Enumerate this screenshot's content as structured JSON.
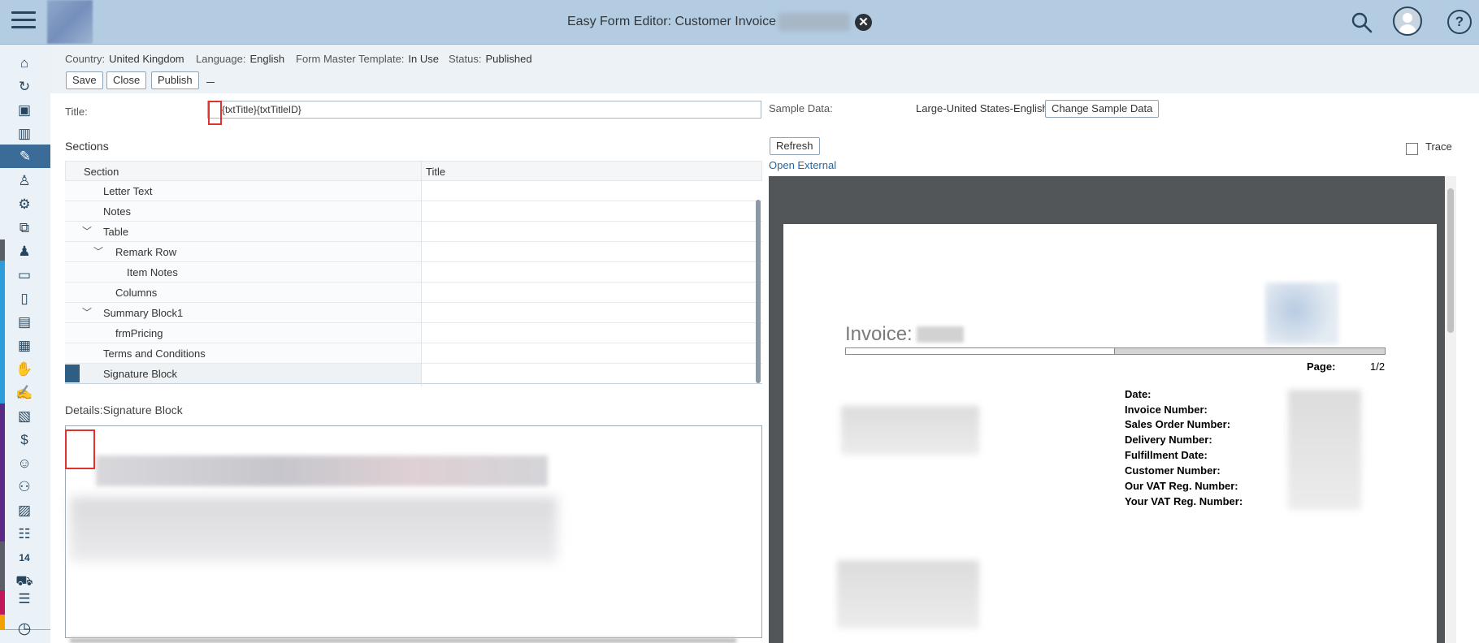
{
  "shell": {
    "app_title": "Easy Form Editor: Customer Invoice",
    "icons": [
      "menu-icon",
      "search-icon",
      "user-avatar-icon",
      "help-icon"
    ]
  },
  "side_nav": {
    "items": [
      "home-icon",
      "refresh-icon",
      "analytics-icon",
      "bar-chart-icon",
      "edit-icon",
      "user-lock-icon",
      "settings-icon",
      "hierarchy-icon",
      "user-list-icon",
      "id-card-icon",
      "document-icon",
      "document-chart-icon",
      "clipboard-icon",
      "handshake-icon",
      "form-edit-icon",
      "ledger-icon",
      "invoice-check-icon",
      "person-icon",
      "network-icon",
      "calendar-edit-icon",
      "group-icon",
      "calendar-14-icon",
      "car-icon",
      "list-icon",
      "history-icon"
    ],
    "calendar_day": "14",
    "active_index": 4,
    "colors": {
      "accent": "#3b6c98",
      "bar_blue": "#2d9cdb",
      "bar_purple": "#5b2a86",
      "bar_magenta": "#c2185b",
      "bar_orange": "#f2a100"
    }
  },
  "form_meta": {
    "country_label": "Country:",
    "country_value": "United Kingdom",
    "language_label": "Language:",
    "language_value": "English",
    "template_label": "Form Master Template:",
    "template_value": "In Use",
    "status_label": "Status:",
    "status_value": "Published"
  },
  "toolbar": {
    "save_label": "Save",
    "close_label": "Close",
    "publish_label": "Publish"
  },
  "title_field": {
    "label": "Title:",
    "value": "{txtTitle}{txtTitleID}"
  },
  "sections": {
    "heading": "Sections",
    "columns": [
      "Section",
      "Title"
    ],
    "rows": [
      {
        "label": "Letter Text",
        "level": 1,
        "expand": ""
      },
      {
        "label": "Notes",
        "level": 1,
        "expand": ""
      },
      {
        "label": "Table",
        "level": 1,
        "expand": "collapse"
      },
      {
        "label": "Remark Row",
        "level": 2,
        "expand": "collapse"
      },
      {
        "label": "Item Notes",
        "level": 3,
        "expand": ""
      },
      {
        "label": "Columns",
        "level": 2,
        "expand": ""
      },
      {
        "label": "Summary Block1",
        "level": 1,
        "expand": "collapse"
      },
      {
        "label": "frmPricing",
        "level": 2,
        "expand": ""
      },
      {
        "label": "Terms and Conditions",
        "level": 1,
        "expand": ""
      },
      {
        "label": "Signature Block",
        "level": 1,
        "expand": "",
        "selected": true
      }
    ]
  },
  "details": {
    "heading": "Details:Signature Block"
  },
  "preview": {
    "sample_label": "Sample Data:",
    "sample_value": "Large-United States-English",
    "change_button": "Change Sample Data",
    "refresh_button": "Refresh",
    "trace_label": "Trace",
    "open_external": "Open External",
    "invoice_title": "Invoice:",
    "page_label": "Page:",
    "page_value": "1/2",
    "fields": [
      "Date:",
      "Invoice Number:",
      "Sales Order Number:",
      "Delivery Number:",
      "Fulfillment Date:",
      "Customer Number:",
      "Our VAT Reg. Number:",
      "Your VAT Reg. Number:"
    ]
  }
}
